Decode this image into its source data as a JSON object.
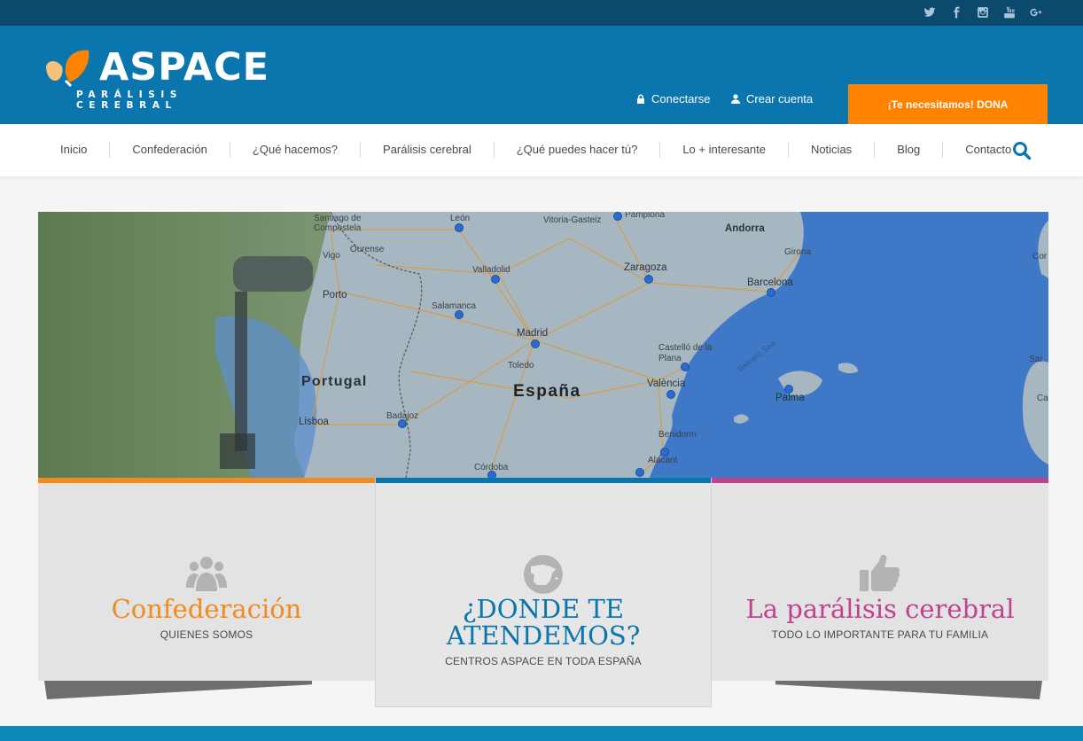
{
  "social": {
    "icons": [
      "twitter-icon",
      "facebook-icon",
      "instagram-icon",
      "youtube-icon",
      "google-plus-icon"
    ],
    "glyphs": [
      "t",
      "f",
      "",
      "",
      "g+"
    ]
  },
  "logo": {
    "name": "ASPACE",
    "tagline": "PARÁLISIS CEREBRAL"
  },
  "account": {
    "login": "Conectarse",
    "register": "Crear cuenta"
  },
  "donate": {
    "label": "¡Te necesitamos! DONA",
    "color": "#ff8300"
  },
  "nav": {
    "items": [
      "Inicio",
      "Confederación",
      "¿Qué hacemos?",
      "Parálisis cerebral",
      "¿Qué puedes hacer tú?",
      "Lo + interesante",
      "Noticias",
      "Blog",
      "Contacto"
    ]
  },
  "map": {
    "countries": {
      "spain": "España",
      "portugal": "Portugal",
      "andorra": "Andorra"
    },
    "sea": "Balearic Sea",
    "cities": {
      "santiago": "Santiago de Compostela",
      "ourense": "Ourense",
      "vigo": "Vigo",
      "porto": "Porto",
      "lisboa": "Lisboa",
      "leon": "León",
      "vitoria": "Vitoria-Gasteiz",
      "pamplona": "Pamplona",
      "valladolid": "Valladolid",
      "zaragoza": "Zaragoza",
      "girona": "Girona",
      "barcelona": "Barcelona",
      "salamanca": "Salamanca",
      "madrid": "Madrid",
      "toledo": "Toledo",
      "castellon": "Castelló de la Plana",
      "valencia": "València",
      "badajoz": "Badajoz",
      "benidorm": "Benidorm",
      "alacant": "Alacant",
      "cordoba": "Córdoba",
      "palma": "Palma",
      "cor": "Cor",
      "sar": "Sar",
      "ca": "Ca"
    }
  },
  "cards": [
    {
      "title": "Confederación",
      "subtitle": "QUIENES SOMOS",
      "color": "#f28a1e"
    },
    {
      "title": "¿DONDE TE ATENDEMOS?",
      "subtitle": "CENTROS ASPACE EN TODA ESPAÑA",
      "color": "#0b76ad"
    },
    {
      "title": "La parálisis cerebral",
      "subtitle": "TODO LO IMPORTANTE PARA TU FAMILIA",
      "color": "#c0418e"
    }
  ]
}
